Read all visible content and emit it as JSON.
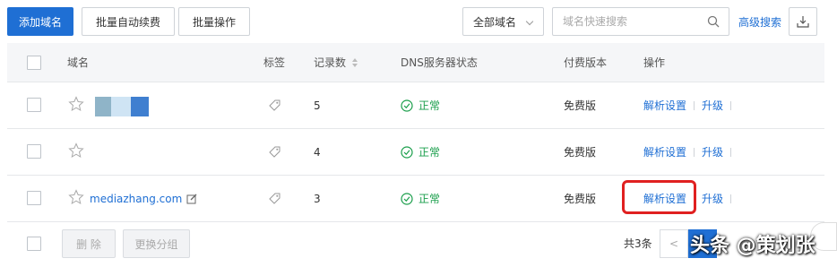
{
  "toolbar": {
    "add_domain": "添加域名",
    "batch_renew": "批量自动续费",
    "batch_ops": "批量操作",
    "filter_select": "全部域名",
    "search_placeholder": "域名快速搜索",
    "advanced_search": "高级搜索"
  },
  "table": {
    "headers": {
      "domain": "域名",
      "tags": "标签",
      "records": "记录数",
      "dns_status": "DNS服务器状态",
      "plan": "付费版本",
      "actions": "操作"
    },
    "rows": [
      {
        "domain": "",
        "records": "5",
        "status": "正常",
        "plan": "免费版",
        "action_resolve": "解析设置",
        "action_upgrade": "升级"
      },
      {
        "domain": "",
        "records": "4",
        "status": "正常",
        "plan": "免费版",
        "action_resolve": "解析设置",
        "action_upgrade": "升级"
      },
      {
        "domain": "mediazhang.com",
        "records": "3",
        "status": "正常",
        "plan": "免费版",
        "action_resolve": "解析设置",
        "action_upgrade": "升级"
      }
    ]
  },
  "footer": {
    "delete": "删 除",
    "change_group": "更换分组",
    "total": "共3条",
    "prev": "<",
    "current_page": "1"
  },
  "watermark": "头条 @策划张",
  "colors": {
    "accent": "#1f6fd4",
    "success": "#1a9e4b",
    "highlight": "#e02020"
  }
}
